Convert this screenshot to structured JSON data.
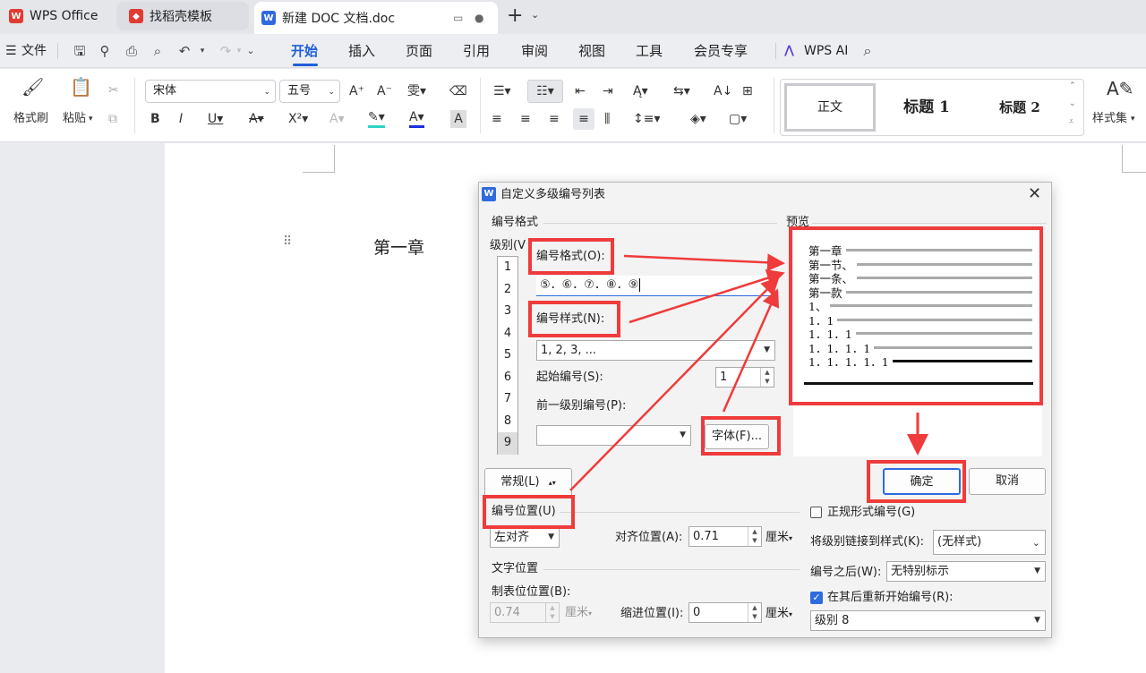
{
  "tabs": [
    {
      "label": "WPS Office",
      "icon": "wps-logo-icon",
      "color": "#e23b32"
    },
    {
      "label": "找稻壳模板",
      "icon": "docer-icon",
      "color": "#e23b32"
    },
    {
      "label": "新建 DOC 文档.doc",
      "icon": "word-doc-icon",
      "color": "#2f6bde"
    }
  ],
  "menu": {
    "file": "文件",
    "items": [
      "开始",
      "插入",
      "页面",
      "引用",
      "审阅",
      "视图",
      "工具",
      "会员专享"
    ],
    "active": "开始",
    "ai": "WPS AI"
  },
  "ribbon": {
    "format_painter": "格式刷",
    "paste": "粘贴",
    "font_name": "宋体",
    "font_size": "五号",
    "styles": [
      "正文",
      "标题 1",
      "标题 2"
    ],
    "style_set": "样式集"
  },
  "document": {
    "heading": "第一章"
  },
  "dialog": {
    "title": "自定义多级编号列表",
    "number_format_group": "编号格式",
    "level_label": "级别(V",
    "levels": [
      "1",
      "2",
      "3",
      "4",
      "5",
      "6",
      "7",
      "8",
      "9"
    ],
    "selected_level": "9",
    "number_format_label": "编号格式(O):",
    "number_format_value": "⑤．⑥．⑦．⑧．⑨",
    "number_style_label": "编号样式(N):",
    "number_style_value": "1, 2, 3, ...",
    "start_at_label": "起始编号(S):",
    "start_at_value": "1",
    "prev_level_label": "前一级别编号(P):",
    "prev_level_value": "",
    "font_button": "字体(F)...",
    "preview_label": "预览",
    "preview_rows": [
      "第一章",
      "第一节、",
      "第一条、",
      "第一款",
      "1、",
      "1．1",
      "1．1．1",
      "1．1．1．1",
      "1．1．1．1．1"
    ],
    "ok": "确定",
    "cancel": "取消",
    "general_button": "常规(L)",
    "number_position_group": "编号位置(U)",
    "alignment_value": "左对齐",
    "align_at_label": "对齐位置(A):",
    "align_at_value": "0.71",
    "unit": "厘米",
    "text_position_group": "文字位置",
    "tab_stop_label": "制表位位置(B):",
    "tab_stop_value": "0.74",
    "indent_label": "缩进位置(I):",
    "indent_value": "0",
    "legal_label": "正规形式编号(G)",
    "link_style_label": "将级别链接到样式(K):",
    "link_style_value": "(无样式)",
    "follow_label": "编号之后(W):",
    "follow_value": "无特别标示",
    "restart_label": "在其后重新开始编号(R):",
    "restart_value": "级别 8"
  },
  "colors": {
    "accent": "#2f6bde",
    "annotation": "#ef3b3b"
  }
}
